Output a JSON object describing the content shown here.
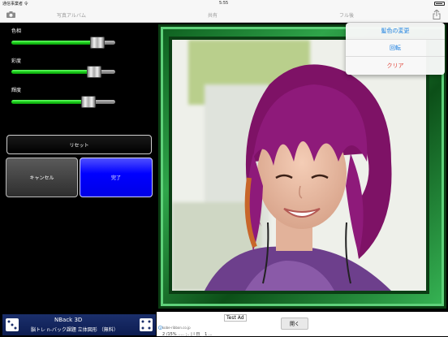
{
  "status_bar": {
    "carrier": "通信事業者 令",
    "time": "5:55"
  },
  "toolbar": {
    "album_label": "写真アルバム",
    "share_label": "共有",
    "fullscreen_label": "フル後"
  },
  "sliders": [
    {
      "label": "色相",
      "value": 0.83
    },
    {
      "label": "彩度",
      "value": 0.8
    },
    {
      "label": "輝度",
      "value": 0.74
    }
  ],
  "buttons": {
    "reset": "リセット",
    "cancel": "キャンセル",
    "done": "完了"
  },
  "menu": {
    "items": [
      "髪色の変更",
      "回転",
      "クリア"
    ],
    "colors": [
      "#1a7fe0",
      "#1a7fe0",
      "#e0453a"
    ]
  },
  "ad_left": {
    "title": "NBack 3D",
    "subtitle": "脳トレ n-バック課題 立体図形 （無料）"
  },
  "ad_right": {
    "test_label": "Test Ad",
    "domain": "kobe-ribbon.co.jp",
    "cut_text": "2 /15% ..... ;.. | l 日 _ 1 ...",
    "open_label": "開く"
  },
  "colors": {
    "accent_blue": "#0000ff",
    "frame_green": "#1f8a38",
    "hair": "#8e1a7a"
  }
}
